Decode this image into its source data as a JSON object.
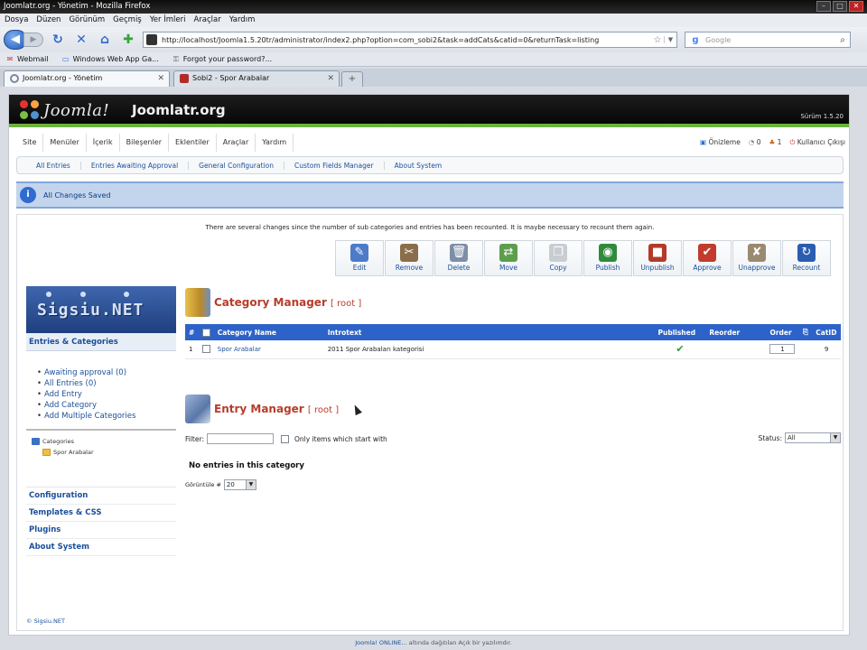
{
  "browser": {
    "window_title": "Joomlatr.org - Yönetim - Mozilla Firefox",
    "menu": [
      "Dosya",
      "Düzen",
      "Görünüm",
      "Geçmiş",
      "Yer İmleri",
      "Araçlar",
      "Yardım"
    ],
    "url": "http://localhost/Joomla1.5.20tr/administrator/index2.php?option=com_sobi2&task=addCats&catid=0&returnTask=listing",
    "search_placeholder": "Google",
    "bookmarks": [
      "Webmail",
      "Windows Web App Ga...",
      "Forgot your password?..."
    ],
    "tabs": [
      {
        "label": "Joomlatr.org - Yönetim",
        "active": true
      },
      {
        "label": "Sobi2 - Spor Arabalar",
        "active": false
      }
    ]
  },
  "admin": {
    "site_name": "Joomlatr.org",
    "logo_text": "Joomla!",
    "version": "Sürüm 1.5.20",
    "menu": [
      "Site",
      "Menüler",
      "İçerik",
      "Bileşenler",
      "Eklentiler",
      "Araçlar",
      "Yardım"
    ],
    "status": {
      "preview": "Önizleme",
      "messages": "0",
      "users": "1",
      "logout": "Kullanıcı Çıkışı"
    },
    "submenu": [
      "All Entries",
      "Entries Awaiting Approval",
      "General Configuration",
      "Custom Fields Manager",
      "About System"
    ],
    "message": "All Changes Saved",
    "notice": "There are several changes since the number of sub categories and entries has been recounted. It is maybe necessary to recount them again.",
    "toolbar": [
      {
        "label": "Edit",
        "icon": "edit-icon",
        "color": "#4c7bc9",
        "glyph": "✎"
      },
      {
        "label": "Remove",
        "icon": "scissors-icon",
        "color": "#8a6d4a",
        "glyph": "✂"
      },
      {
        "label": "Delete",
        "icon": "trash-icon",
        "color": "#7d8fa8",
        "glyph": "🗑"
      },
      {
        "label": "Move",
        "icon": "move-icon",
        "color": "#5d9e4c",
        "glyph": "⇄"
      },
      {
        "label": "Copy",
        "icon": "copy-icon",
        "color": "#c9ccd1",
        "glyph": "❐"
      },
      {
        "label": "Publish",
        "icon": "publish-icon",
        "color": "#2f8a3c",
        "glyph": "◉"
      },
      {
        "label": "Unpublish",
        "icon": "unpublish-icon",
        "color": "#b33a2a",
        "glyph": "■"
      },
      {
        "label": "Approve",
        "icon": "approve-icon",
        "color": "#c23b2c",
        "glyph": "✔"
      },
      {
        "label": "Unapprove",
        "icon": "unapprove-icon",
        "color": "#9a8a70",
        "glyph": "✘"
      },
      {
        "label": "Recount",
        "icon": "recount-icon",
        "color": "#2a5db0",
        "glyph": "↻"
      }
    ],
    "sidebar": {
      "logo_text": "Sigsiu.NET",
      "heading": "Entries & Categories",
      "links": [
        "Awaiting approval (0)",
        "All Entries (0)",
        "Add Entry",
        "Add Category",
        "Add Multiple Categories"
      ],
      "tree_root": "Categories",
      "tree_child": "Spor Arabalar",
      "bottom_links": [
        "Configuration",
        "Templates & CSS",
        "Plugins",
        "About System"
      ],
      "copyright": "© Sigsiu.NET"
    },
    "category_manager": {
      "title": "Category Manager",
      "path": "[ root ]",
      "columns": [
        "#",
        "",
        "Category Name",
        "Introtext",
        "Published",
        "Reorder",
        "Order",
        "",
        "CatID"
      ],
      "rows": [
        {
          "num": "1",
          "name": "Spor Arabalar",
          "introtext": "2011 Spor Arabaları kategorisi",
          "published": "✔",
          "order": "1",
          "catid": "9"
        }
      ]
    },
    "entry_manager": {
      "title": "Entry Manager",
      "path": "[ root ]",
      "filter_label": "Filter:",
      "filter_value": "",
      "only_items_label": "Only items which start with",
      "status_label": "Status:",
      "status_value": "All",
      "no_entries": "No entries in this category",
      "display_label": "Görüntüle #",
      "display_value": "20"
    },
    "footer": {
      "link": "Joomla! ONLINE...",
      "text": "altında dağıtılan Açık bir yazılımdır."
    }
  }
}
